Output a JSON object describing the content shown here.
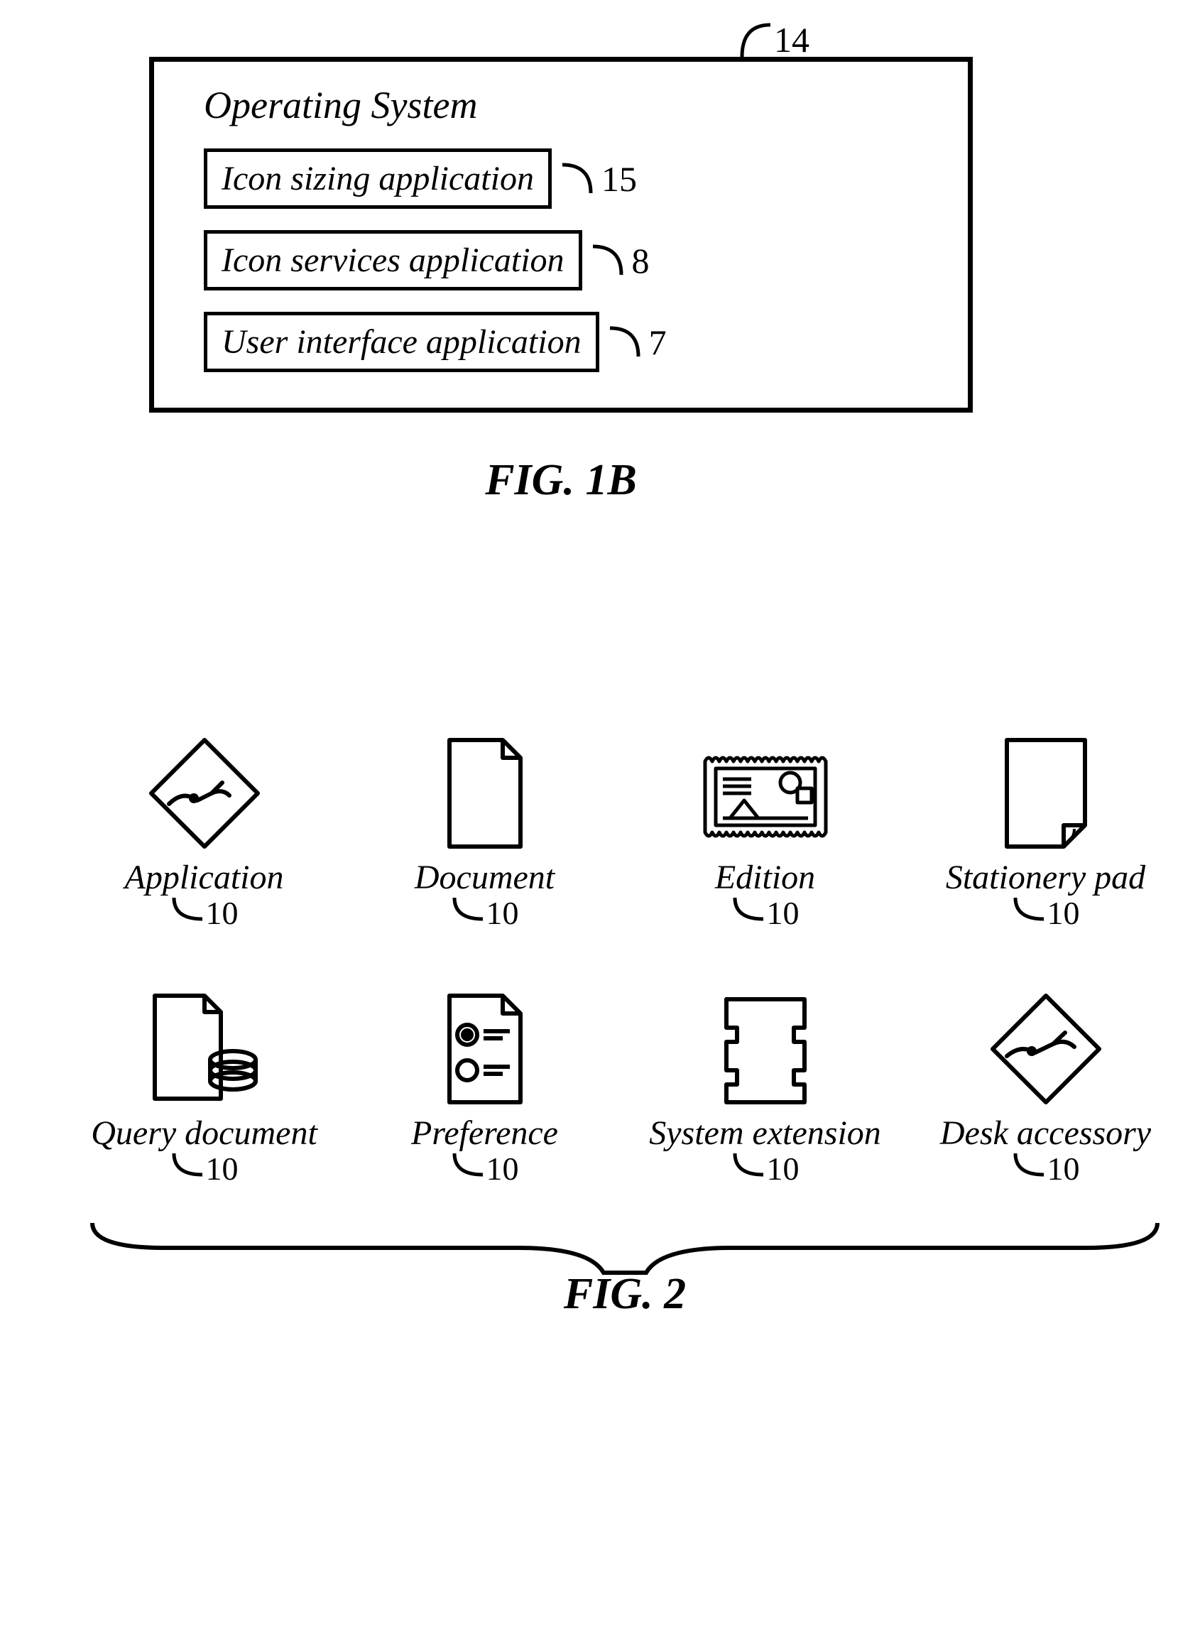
{
  "fig1b": {
    "container_ref": "14",
    "title": "Operating System",
    "apps": [
      {
        "label": "Icon sizing application",
        "ref": "15"
      },
      {
        "label": "Icon services application",
        "ref": "8"
      },
      {
        "label": "User interface application",
        "ref": "7"
      }
    ],
    "caption": "FIG. 1B"
  },
  "fig2": {
    "icons": [
      {
        "label": "Application",
        "ref": "10"
      },
      {
        "label": "Document",
        "ref": "10"
      },
      {
        "label": "Edition",
        "ref": "10"
      },
      {
        "label": "Stationery pad",
        "ref": "10"
      },
      {
        "label": "Query document",
        "ref": "10"
      },
      {
        "label": "Preference",
        "ref": "10"
      },
      {
        "label": "System extension",
        "ref": "10"
      },
      {
        "label": "Desk accessory",
        "ref": "10"
      }
    ],
    "caption": "FIG. 2"
  }
}
